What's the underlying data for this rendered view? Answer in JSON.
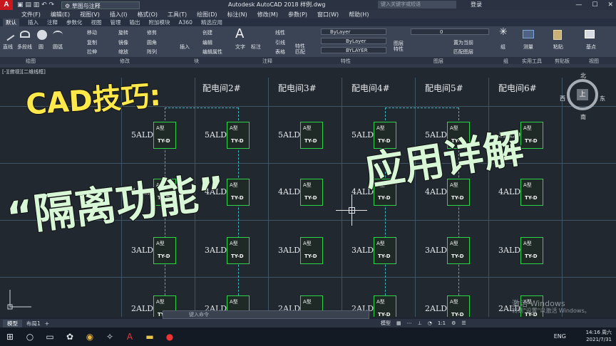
{
  "titlebar": {
    "app_icon": "A",
    "quick_access": "▣ ▤ ▥ ↶ ↷",
    "workspace": "⚙ 草图与注释",
    "app_title": "Autodesk AutoCAD 2018    样例.dwg",
    "search_placeholder": "键入关键字或短语",
    "login": "登录",
    "min": "—",
    "max": "☐",
    "close": "✕"
  },
  "menubar": [
    "文件(F)",
    "编辑(E)",
    "视图(V)",
    "插入(I)",
    "格式(O)",
    "工具(T)",
    "绘图(D)",
    "标注(N)",
    "修改(M)",
    "参数(P)",
    "窗口(W)",
    "帮助(H)"
  ],
  "ribbon_tabs": [
    "默认",
    "插入",
    "注释",
    "参数化",
    "视图",
    "管理",
    "输出",
    "附加模块",
    "A360",
    "精选应用"
  ],
  "ribbon": {
    "line": "直线",
    "polyline": "多段线",
    "circle": "圆",
    "arc": "圆弧",
    "move": "移动",
    "rotate": "旋转",
    "trim": "修剪",
    "copy": "复制",
    "mirror": "镜像",
    "fillet": "圆角",
    "stretch": "拉伸",
    "scale": "缩放",
    "array": "阵列",
    "insert": "插入",
    "create": "创建",
    "edit": "编辑",
    "edit_attr": "编辑属性",
    "text": "文字",
    "dimension": "标注",
    "linear": "线性",
    "leader": "引线",
    "table": "表格",
    "match_props": "特性\n匹配",
    "bylayer1": "ByLayer",
    "bylayer2": "ByLayer",
    "bylayer3": "BYLAYER",
    "layer_props": "图层\n特性",
    "layer_value": "0",
    "set_current": "置为当前",
    "match_layer": "匹配图层",
    "group": "组",
    "measure": "测量",
    "paste": "粘贴",
    "base": "基点"
  },
  "panels": [
    "绘图",
    "修改",
    "块",
    "注释",
    "特性",
    "图层",
    "组",
    "实用工具",
    "剪贴板",
    "视图"
  ],
  "canvas": {
    "view_label": "[-][俯视][二维线框]",
    "headers": [
      "配电间2#",
      "配电间3#",
      "配电间4#",
      "配电间5#",
      "配电间6#"
    ],
    "rows": [
      [
        "5ALD1",
        "5ALD2",
        "5ALD3",
        "5ALD4",
        "5ALD5",
        "5ALD6"
      ],
      [
        "4ALD1",
        "4ALD2",
        "4ALD3",
        "4ALD4",
        "4ALD5",
        "4ALD6"
      ],
      [
        "3ALD1",
        "3ALD2",
        "3ALD3",
        "3ALD4",
        "3ALD5",
        "3ALD6"
      ],
      [
        "2ALD1",
        "2ALD2",
        "2ALD3",
        "2ALD4",
        "2ALD5",
        "2ALD6"
      ]
    ],
    "box_top": "A型",
    "box_bottom": "TY-D",
    "compass": {
      "n": "北",
      "s": "南",
      "w": "西",
      "e": "东",
      "top": "上"
    },
    "cmd_placeholder": "键入命令"
  },
  "overlay": {
    "line1": "CAD技巧:",
    "line2": "“隔离功能”",
    "line3": "应用详解"
  },
  "layout_tabs": [
    "模型",
    "布局1",
    "+"
  ],
  "status": {
    "model": "模型",
    "scale": "1:1"
  },
  "watermark": {
    "line1": "激活 Windows",
    "line2": "转到\"设置\"以激活 Windows。"
  },
  "taskbar": {
    "lang": "ENG",
    "time": "14:16 周六",
    "date": "2021/7/31"
  }
}
